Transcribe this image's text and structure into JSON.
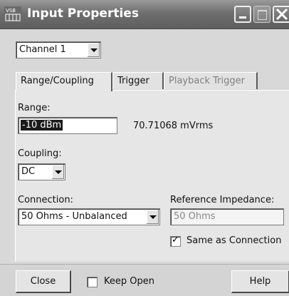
{
  "window": {
    "title": "Input Properties",
    "icon_text": "VSB"
  },
  "channel": {
    "selected": "Channel 1"
  },
  "tabs": [
    {
      "label": "Range/Coupling",
      "active": true,
      "enabled": true
    },
    {
      "label": "Trigger",
      "active": false,
      "enabled": true
    },
    {
      "label": "Playback Trigger",
      "active": false,
      "enabled": false
    }
  ],
  "range": {
    "label": "Range:",
    "value": "-10 dBm",
    "readout": "70.71068 mVrms"
  },
  "coupling": {
    "label": "Coupling:",
    "selected": "DC"
  },
  "connection": {
    "label": "Connection:",
    "selected": "50 Ohms - Unbalanced"
  },
  "reference_impedance": {
    "label": "Reference Impedance:",
    "value": "50 Ohms"
  },
  "same_as_connection": {
    "label": "Same as Connection",
    "checked": true
  },
  "footer": {
    "close_label": "Close",
    "keep_open_label": "Keep Open",
    "keep_open_checked": false,
    "help_label": "Help"
  }
}
